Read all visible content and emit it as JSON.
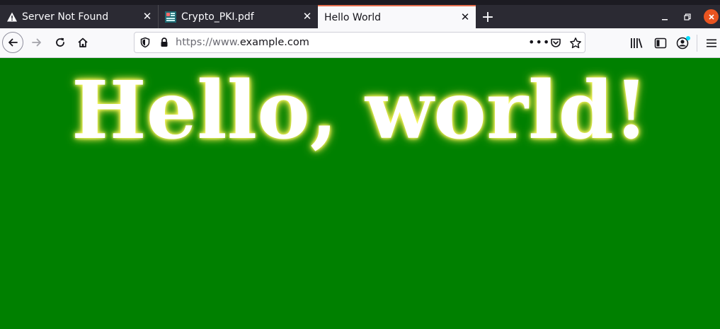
{
  "browser": {
    "tabs": [
      {
        "title": "Server Not Found",
        "icon": "warning-icon",
        "active": false
      },
      {
        "title": "Crypto_PKI.pdf",
        "icon": "pdf-file-icon",
        "active": false
      },
      {
        "title": "Hello World",
        "icon": "",
        "active": true
      }
    ],
    "close_glyph": "✕",
    "new_tab_glyph": "+",
    "url": {
      "scheme": "https://www.",
      "host": "example.com",
      "more_glyph": "•••"
    },
    "colors": {
      "tab_accent": "#e66f4e",
      "window_close": "#e95420",
      "toolbar_bg": "#f9f9fb"
    }
  },
  "page": {
    "headline": "Hello, world!",
    "background": "#008000",
    "headline_color": "#ffffff",
    "glow_color": "#ffff66"
  }
}
